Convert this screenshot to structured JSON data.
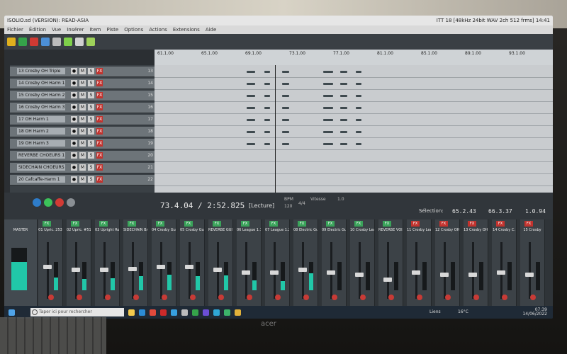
{
  "titlebar": {
    "left": "ISOLIO.sd (VERSION): READ-ASIA",
    "right": "ITT 18 [48kHz 24bit WAV 2ch 512 frms] 14:41"
  },
  "menubar": {
    "items": [
      "Fichier",
      "Édition",
      "Vue",
      "Insérer",
      "Item",
      "Piste",
      "Options",
      "Actions",
      "Extensions",
      "Aide"
    ]
  },
  "ruler": {
    "ticks": [
      "61.1.00",
      "65.1.00",
      "69.1.00",
      "73.1.00",
      "77.1.00",
      "81.1.00",
      "85.1.00",
      "89.1.00",
      "93.1.00"
    ]
  },
  "tracks": [
    {
      "name": "13 Crosby OH Triple",
      "num": "13"
    },
    {
      "name": "14 Crosby OH Harm 1",
      "num": "14"
    },
    {
      "name": "15 Crosby OH Harm 2",
      "num": "15"
    },
    {
      "name": "16 Crosby OH Harm 3",
      "num": "16"
    },
    {
      "name": "17 OH Harm 1",
      "num": "17"
    },
    {
      "name": "18 OH Harm 2",
      "num": "18"
    },
    {
      "name": "19 OH Harm 3",
      "num": "19"
    },
    {
      "name": "REVERBE CHOEURS 1",
      "num": "20"
    },
    {
      "name": "SIDECHAIN CHOEURS",
      "num": "21"
    },
    {
      "name": "20 Cafcaffe-Harm 1",
      "num": "22"
    }
  ],
  "transport": {
    "time": "73.4.04 / 2:52.825",
    "state": "[Lecture]",
    "bpm_label": "BPM",
    "bpm": "120",
    "sig": "4/4",
    "rate_label": "Vitesse",
    "rate": "1.0",
    "selection_label": "Sélection:",
    "sel_start": "65.2.43",
    "sel_end": "66.3.37",
    "sel_len": "1.0.94"
  },
  "mixer": {
    "master": "MASTER",
    "strips": [
      {
        "name": "01 Upric. 253",
        "fx": "green",
        "fader": 0.55,
        "meter": 0.45
      },
      {
        "name": "02 Upric. #51",
        "fx": "green",
        "fader": 0.5,
        "meter": 0.4
      },
      {
        "name": "03 Upright Rox",
        "fx": "green",
        "fader": 0.5,
        "meter": 0.42
      },
      {
        "name": "SIDECHAIN BA",
        "fx": "green",
        "fader": 0.52,
        "meter": 0.5
      },
      {
        "name": "04 Crosby Gui",
        "fx": "green",
        "fader": 0.55,
        "meter": 0.55
      },
      {
        "name": "05 Crosby Gui",
        "fx": "green",
        "fader": 0.55,
        "meter": 0.5
      },
      {
        "name": "REVERBE GUIT",
        "fx": "green",
        "fader": 0.5,
        "meter": 0.52
      },
      {
        "name": "06 League 1.1",
        "fx": "green",
        "fader": 0.45,
        "meter": 0.35
      },
      {
        "name": "07 League 1.2",
        "fx": "green",
        "fader": 0.45,
        "meter": 0.32
      },
      {
        "name": "08 Electric Gu",
        "fx": "green",
        "fader": 0.5,
        "meter": 0.6
      },
      {
        "name": "09 Electric Gu",
        "fx": "green",
        "fader": 0.45,
        "meter": 0.0
      },
      {
        "name": "10 Crosby Lea",
        "fx": "green",
        "fader": 0.4,
        "meter": 0.0
      },
      {
        "name": "REVERBE VOIX",
        "fx": "green",
        "fader": 0.3,
        "meter": 0.0
      },
      {
        "name": "11 Crosby Leac",
        "fx": "red",
        "fader": 0.45,
        "meter": 0.0
      },
      {
        "name": "12 Crosby OH",
        "fx": "red",
        "fader": 0.4,
        "meter": 0.0
      },
      {
        "name": "13 Crosby OH",
        "fx": "red",
        "fader": 0.4,
        "meter": 0.0
      },
      {
        "name": "14 Crosby C.",
        "fx": "red",
        "fader": 0.45,
        "meter": 0.0
      },
      {
        "name": "15 Crosby",
        "fx": "red",
        "fader": 0.4,
        "meter": 0.0
      }
    ]
  },
  "taskbar": {
    "search_placeholder": "Taper ici pour rechercher",
    "weather": "16°C",
    "lang": "Liens",
    "time": "07:39",
    "date": "14/06/2022"
  },
  "brand": "acer"
}
